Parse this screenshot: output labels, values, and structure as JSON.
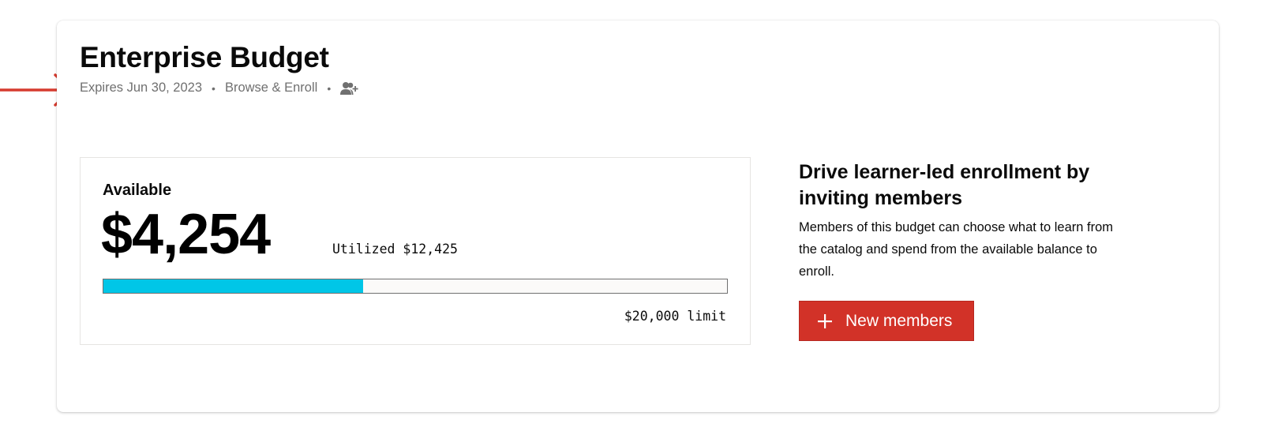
{
  "budget": {
    "title": "Enterprise Budget",
    "expires": "Expires Jun 30, 2023",
    "separator": "•",
    "mode": "Browse & Enroll",
    "available_label": "Available",
    "available_amount": "$4,254",
    "utilized_text": "Utilized $12,425",
    "limit_text": "$20,000 limit",
    "utilized_fraction": 0.4165
  },
  "invite": {
    "heading": "Drive learner-led enrollment by inviting members",
    "description": "Members of this budget can choose what to learn from the catalog and spend from the available balance to enroll.",
    "button_label": "New members"
  },
  "icons": {
    "invite": "person-add-icon",
    "plus": "plus-icon",
    "annotation": "arrow-right-icon"
  },
  "colors": {
    "accent": "#00c6e7",
    "button": "#d23228",
    "annotation": "#d63b2f",
    "muted_text": "#707070"
  }
}
